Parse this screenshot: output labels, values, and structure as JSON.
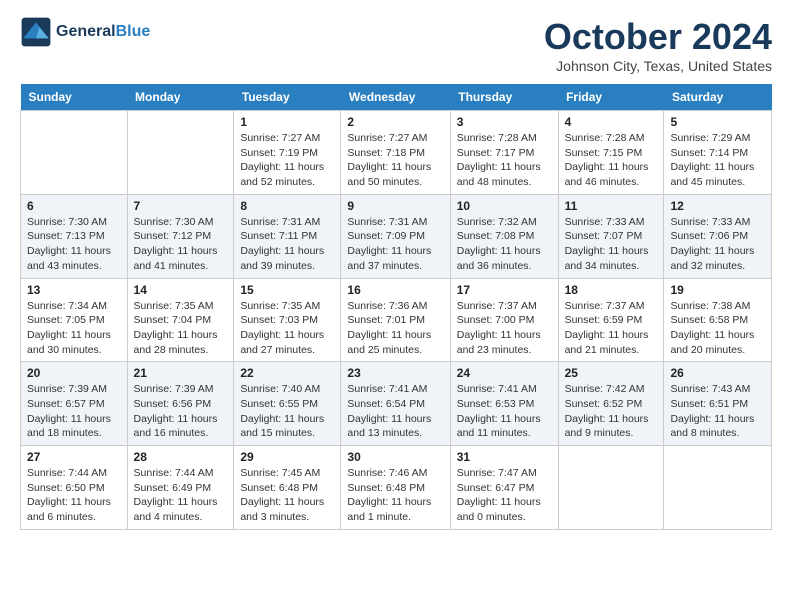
{
  "header": {
    "logo_line1": "General",
    "logo_line2": "Blue",
    "month_title": "October 2024",
    "location": "Johnson City, Texas, United States"
  },
  "weekdays": [
    "Sunday",
    "Monday",
    "Tuesday",
    "Wednesday",
    "Thursday",
    "Friday",
    "Saturday"
  ],
  "weeks": [
    [
      {
        "day": "",
        "info": ""
      },
      {
        "day": "",
        "info": ""
      },
      {
        "day": "1",
        "info": "Sunrise: 7:27 AM\nSunset: 7:19 PM\nDaylight: 11 hours\nand 52 minutes."
      },
      {
        "day": "2",
        "info": "Sunrise: 7:27 AM\nSunset: 7:18 PM\nDaylight: 11 hours\nand 50 minutes."
      },
      {
        "day": "3",
        "info": "Sunrise: 7:28 AM\nSunset: 7:17 PM\nDaylight: 11 hours\nand 48 minutes."
      },
      {
        "day": "4",
        "info": "Sunrise: 7:28 AM\nSunset: 7:15 PM\nDaylight: 11 hours\nand 46 minutes."
      },
      {
        "day": "5",
        "info": "Sunrise: 7:29 AM\nSunset: 7:14 PM\nDaylight: 11 hours\nand 45 minutes."
      }
    ],
    [
      {
        "day": "6",
        "info": "Sunrise: 7:30 AM\nSunset: 7:13 PM\nDaylight: 11 hours\nand 43 minutes."
      },
      {
        "day": "7",
        "info": "Sunrise: 7:30 AM\nSunset: 7:12 PM\nDaylight: 11 hours\nand 41 minutes."
      },
      {
        "day": "8",
        "info": "Sunrise: 7:31 AM\nSunset: 7:11 PM\nDaylight: 11 hours\nand 39 minutes."
      },
      {
        "day": "9",
        "info": "Sunrise: 7:31 AM\nSunset: 7:09 PM\nDaylight: 11 hours\nand 37 minutes."
      },
      {
        "day": "10",
        "info": "Sunrise: 7:32 AM\nSunset: 7:08 PM\nDaylight: 11 hours\nand 36 minutes."
      },
      {
        "day": "11",
        "info": "Sunrise: 7:33 AM\nSunset: 7:07 PM\nDaylight: 11 hours\nand 34 minutes."
      },
      {
        "day": "12",
        "info": "Sunrise: 7:33 AM\nSunset: 7:06 PM\nDaylight: 11 hours\nand 32 minutes."
      }
    ],
    [
      {
        "day": "13",
        "info": "Sunrise: 7:34 AM\nSunset: 7:05 PM\nDaylight: 11 hours\nand 30 minutes."
      },
      {
        "day": "14",
        "info": "Sunrise: 7:35 AM\nSunset: 7:04 PM\nDaylight: 11 hours\nand 28 minutes."
      },
      {
        "day": "15",
        "info": "Sunrise: 7:35 AM\nSunset: 7:03 PM\nDaylight: 11 hours\nand 27 minutes."
      },
      {
        "day": "16",
        "info": "Sunrise: 7:36 AM\nSunset: 7:01 PM\nDaylight: 11 hours\nand 25 minutes."
      },
      {
        "day": "17",
        "info": "Sunrise: 7:37 AM\nSunset: 7:00 PM\nDaylight: 11 hours\nand 23 minutes."
      },
      {
        "day": "18",
        "info": "Sunrise: 7:37 AM\nSunset: 6:59 PM\nDaylight: 11 hours\nand 21 minutes."
      },
      {
        "day": "19",
        "info": "Sunrise: 7:38 AM\nSunset: 6:58 PM\nDaylight: 11 hours\nand 20 minutes."
      }
    ],
    [
      {
        "day": "20",
        "info": "Sunrise: 7:39 AM\nSunset: 6:57 PM\nDaylight: 11 hours\nand 18 minutes."
      },
      {
        "day": "21",
        "info": "Sunrise: 7:39 AM\nSunset: 6:56 PM\nDaylight: 11 hours\nand 16 minutes."
      },
      {
        "day": "22",
        "info": "Sunrise: 7:40 AM\nSunset: 6:55 PM\nDaylight: 11 hours\nand 15 minutes."
      },
      {
        "day": "23",
        "info": "Sunrise: 7:41 AM\nSunset: 6:54 PM\nDaylight: 11 hours\nand 13 minutes."
      },
      {
        "day": "24",
        "info": "Sunrise: 7:41 AM\nSunset: 6:53 PM\nDaylight: 11 hours\nand 11 minutes."
      },
      {
        "day": "25",
        "info": "Sunrise: 7:42 AM\nSunset: 6:52 PM\nDaylight: 11 hours\nand 9 minutes."
      },
      {
        "day": "26",
        "info": "Sunrise: 7:43 AM\nSunset: 6:51 PM\nDaylight: 11 hours\nand 8 minutes."
      }
    ],
    [
      {
        "day": "27",
        "info": "Sunrise: 7:44 AM\nSunset: 6:50 PM\nDaylight: 11 hours\nand 6 minutes."
      },
      {
        "day": "28",
        "info": "Sunrise: 7:44 AM\nSunset: 6:49 PM\nDaylight: 11 hours\nand 4 minutes."
      },
      {
        "day": "29",
        "info": "Sunrise: 7:45 AM\nSunset: 6:48 PM\nDaylight: 11 hours\nand 3 minutes."
      },
      {
        "day": "30",
        "info": "Sunrise: 7:46 AM\nSunset: 6:48 PM\nDaylight: 11 hours\nand 1 minute."
      },
      {
        "day": "31",
        "info": "Sunrise: 7:47 AM\nSunset: 6:47 PM\nDaylight: 11 hours\nand 0 minutes."
      },
      {
        "day": "",
        "info": ""
      },
      {
        "day": "",
        "info": ""
      }
    ]
  ]
}
